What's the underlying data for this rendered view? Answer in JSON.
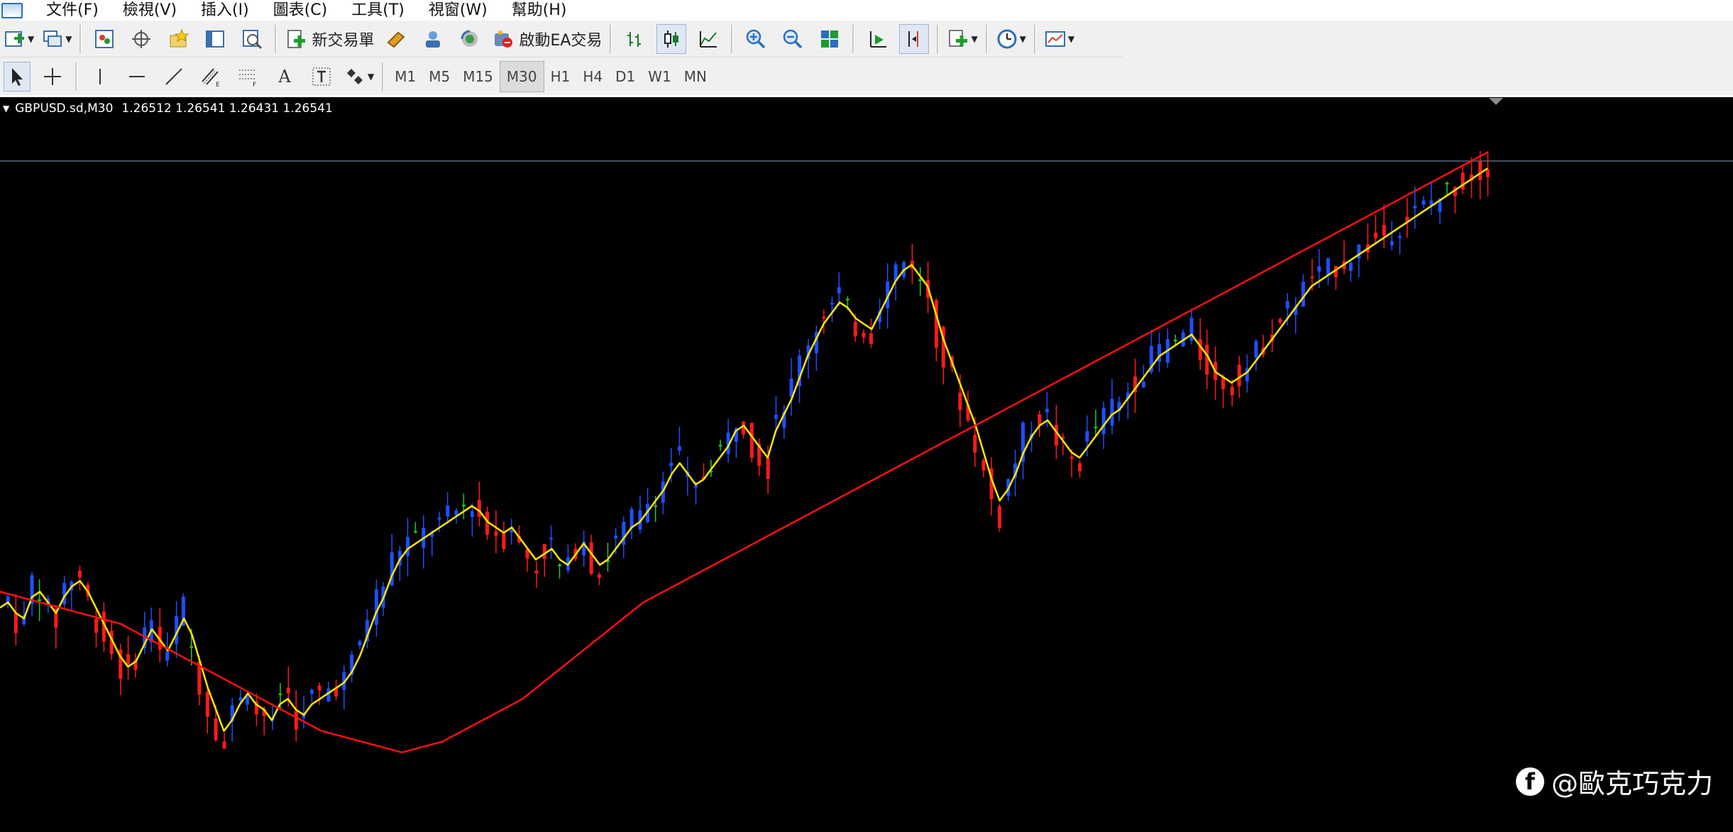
{
  "menu": {
    "items": [
      "文件(F)",
      "檢視(V)",
      "插入(I)",
      "圖表(C)",
      "工具(T)",
      "視窗(W)",
      "幫助(H)"
    ]
  },
  "toolbar": {
    "new_order_label": "新交易單",
    "autotrade_label": "啟動EA交易",
    "icons": [
      "new-chart-icon",
      "profiles-icon",
      "market-watch-icon",
      "navigator-icon",
      "favorites-icon",
      "data-window-icon",
      "strategy-tester-icon",
      "new-order-icon",
      "metaeditor-icon",
      "signals-icon",
      "market-icon",
      "autotrading-icon",
      "bar-chart-icon",
      "candlestick-icon",
      "line-chart-icon",
      "zoom-in-icon",
      "zoom-out-icon",
      "tile-windows-icon",
      "autoscroll-icon",
      "chart-shift-icon",
      "indicators-icon",
      "periods-icon",
      "templates-icon"
    ]
  },
  "drawing_toolbar": {
    "tools": [
      "cursor-icon",
      "crosshair-icon",
      "vertical-line-icon",
      "horizontal-line-icon",
      "trendline-icon",
      "equidistant-channel-icon",
      "fibonacci-icon",
      "text-icon",
      "text-label-icon",
      "arrows-icon"
    ],
    "text_tool": "A",
    "timeframes": [
      "M1",
      "M5",
      "M15",
      "M30",
      "H1",
      "H4",
      "D1",
      "W1",
      "MN"
    ],
    "active_timeframe": "M30"
  },
  "chart": {
    "symbol": "GBPUSD.sd,M30",
    "ohlc": "1.26512 1.26541 1.26431 1.26541",
    "colors": {
      "bull": "#1f4fff",
      "bear": "#ff1a1a",
      "doji": "#22cc22",
      "ma_fast": "#ffe800",
      "ma_slow": "#ff1010",
      "bid_line": "#5a6a80"
    }
  },
  "watermark": {
    "text": "@歐克巧克力",
    "icon": "f"
  },
  "chart_data": {
    "type": "candlestick",
    "title": "",
    "xlabel": "",
    "ylabel": "",
    "series": [
      {
        "name": "",
        "values": [
          40,
          42,
          38,
          36,
          44,
          46,
          42,
          38,
          44,
          48,
          50,
          46,
          40,
          34,
          28,
          22,
          18,
          20,
          26,
          32,
          28,
          24,
          30,
          36,
          30,
          20,
          10,
          2,
          -6,
          -2,
          4,
          8,
          4,
          2,
          -2,
          4,
          6,
          2,
          0,
          4,
          6,
          8,
          10,
          12,
          16,
          22,
          30,
          38,
          44,
          52,
          58,
          62,
          64,
          66,
          68,
          70,
          72,
          74,
          76,
          78,
          76,
          72,
          70,
          68,
          70,
          66,
          62,
          58,
          60,
          62,
          58,
          56,
          60,
          64,
          60,
          56,
          58,
          62,
          66,
          70,
          72,
          76,
          80,
          84,
          90,
          94,
          90,
          86,
          88,
          92,
          96,
          100,
          106,
          108,
          104,
          100,
          96,
          106,
          112,
          118,
          126,
          134,
          140,
          146,
          150,
          154,
          152,
          148,
          146,
          144,
          150,
          156,
          162,
          166,
          168,
          164,
          160,
          150,
          140,
          132,
          124,
          116,
          108,
          98,
          88,
          80,
          84,
          90,
          98,
          104,
          108,
          110,
          106,
          102,
          98,
          96,
          100,
          104,
          108,
          112,
          114,
          118,
          122,
          126,
          130,
          134,
          136,
          138,
          140,
          142,
          138,
          134,
          128,
          126,
          124,
          126,
          128,
          132,
          136,
          140,
          144,
          148,
          152,
          156,
          160,
          162,
          164,
          166,
          168,
          170,
          172,
          174,
          176,
          178,
          180,
          182,
          184,
          186,
          188,
          190,
          192,
          194,
          196,
          198,
          200,
          202,
          204
        ]
      },
      {
        "name": "",
        "values": [
          46,
          44,
          42,
          40,
          38,
          36,
          34,
          30,
          26,
          22,
          18,
          14,
          10,
          6,
          2,
          -2,
          -6,
          -8,
          -10,
          -12,
          -14,
          -12,
          -10,
          -6,
          -2,
          2,
          6,
          12,
          18,
          24,
          30,
          36,
          42,
          46,
          50,
          54,
          58,
          62,
          66,
          70,
          74,
          78,
          82,
          86,
          90,
          94,
          98,
          102,
          106,
          110,
          114,
          118,
          122,
          126,
          130,
          134,
          138,
          142,
          146,
          150,
          154,
          158,
          162,
          166,
          170,
          174,
          178,
          182,
          186,
          190,
          194,
          198,
          202,
          206,
          210
        ]
      }
    ]
  }
}
